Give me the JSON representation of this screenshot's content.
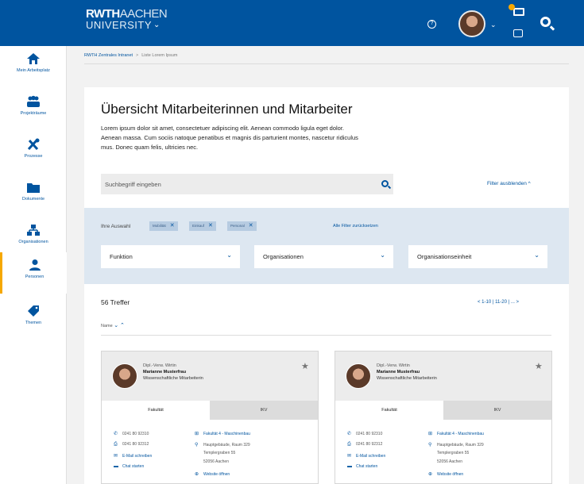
{
  "header": {
    "logo_line1": "RWTH",
    "logo_line1b": "AACHEN",
    "logo_line2": "UNIVERSITY"
  },
  "sidebar": {
    "items": [
      {
        "label": "Mein Arbeitsplatz",
        "icon": "home-icon"
      },
      {
        "label": "Projekträume",
        "icon": "group-icon"
      },
      {
        "label": "Prozesse",
        "icon": "tools-icon"
      },
      {
        "label": "Dokumente",
        "icon": "folder-icon"
      },
      {
        "label": "Organisationen",
        "icon": "org-chart-icon"
      },
      {
        "label": "Personen",
        "icon": "person-icon",
        "active": true
      },
      {
        "label": "Themen",
        "icon": "tag-icon"
      }
    ]
  },
  "breadcrumb": {
    "root": "RWTH Zentrales Intranet",
    "separator": ">",
    "current": "Liste Lorem Ipsum"
  },
  "main": {
    "title": "Übersicht Mitarbeiterinnen und Mitarbeiter",
    "intro": "Lorem ipsum dolor sit amet, consectetuer adipiscing elit. Aenean commodo ligula eget dolor. Aenean massa. Cum sociis natoque penatibus et magnis dis parturient montes, nascetur ridiculus mus. Donec quam felis, ultricies nec.",
    "search_placeholder": "Suchbegriff eingeben",
    "filter_toggle": "Filter ausblenden ^"
  },
  "filters": {
    "selection_label": "Ihre Auswahl",
    "chips": [
      "Mobilität",
      "Einkauf",
      "Personal"
    ],
    "reset": "Alle Filter zurücksetzen",
    "selects": [
      "Funktion",
      "Organisationen",
      "Organisationseinheit"
    ]
  },
  "results": {
    "count": "56 Treffer",
    "pager": "< 1-10 | 11-20 | ... >",
    "sort_label": "Name"
  },
  "cards": [
    {
      "title": "Dipl.-Verw. Wirtin",
      "name": "Marianne Musterfrau",
      "position": "Wissenschaftliche Mitarbeiterin",
      "tab_active": "Fakultät",
      "tab_inactive": "IKV",
      "phone": "0241 80 92310",
      "fax": "0241 80 92312",
      "email": "E-Mail schreiben",
      "chat": "Chat starten",
      "org": "Fakultät 4 - Maschinenbau",
      "address1": "Hauptgebäude, Raum 329",
      "address2": "Templergraben 55",
      "address3": "52056 Aachen",
      "website": "Website öffnen"
    },
    {
      "title": "Dipl.-Verw. Wirtin",
      "name": "Marianne Musterfrau",
      "position": "Wissenschaftliche Mitarbeiterin",
      "tab_active": "Fakultät",
      "tab_inactive": "IKV",
      "phone": "0241 80 92310",
      "fax": "0241 80 92312",
      "email": "E-Mail schreiben",
      "chat": "Chat starten",
      "org": "Fakultät 4 - Maschinenbau",
      "address1": "Hauptgebäude, Raum 329",
      "address2": "Templergraben 55",
      "address3": "52056 Aachen",
      "website": "Website öffnen"
    }
  ],
  "colors": {
    "brand_blue": "#00549f",
    "accent_orange": "#f6a800",
    "filter_bg": "#dde7f1"
  }
}
